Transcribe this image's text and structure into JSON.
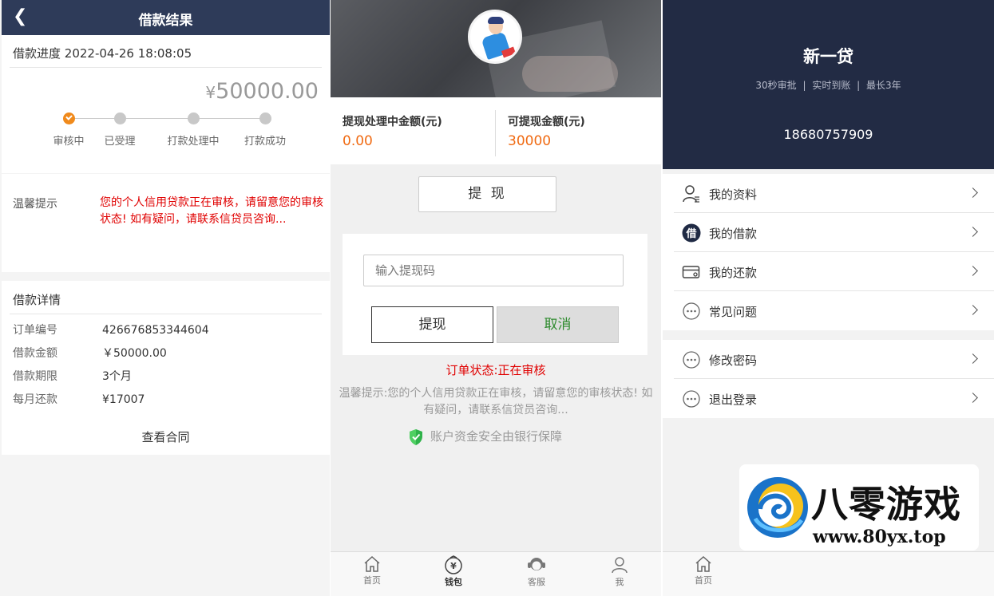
{
  "loan_result": {
    "header_title": "借款结果",
    "progress_label": "借款进度",
    "progress_time": "2022-04-26 18:08:05",
    "amount_symbol": "¥",
    "amount_value": "50000.00",
    "steps": [
      {
        "label": "审核中",
        "state": "done"
      },
      {
        "label": "已受理",
        "state": "pending"
      },
      {
        "label": "打款处理中",
        "state": "pending"
      },
      {
        "label": "打款成功",
        "state": "pending"
      }
    ],
    "tip_label": "温馨提示",
    "tip_text": "您的个人信用贷款正在审核，请留意您的审核状态! 如有疑问，请联系信贷员咨询...",
    "detail_title": "借款详情",
    "details": [
      {
        "key": "订单编号",
        "value": "426676853344604"
      },
      {
        "key": "借款金额",
        "value": "￥50000.00"
      },
      {
        "key": "借款期限",
        "value": "3个月"
      },
      {
        "key": "每月还款",
        "value": "¥17007"
      }
    ],
    "contract_label": "查看合同"
  },
  "wallet": {
    "processing_label": "提现处理中金额(元)",
    "processing_value": "0.00",
    "available_label": "可提现金额(元)",
    "available_value": "30000",
    "withdraw_button": "提 现",
    "code_placeholder": "输入提现码",
    "confirm_button": "提现",
    "cancel_button": "取消",
    "order_status": "订单状态:正在审核",
    "tip_text": "温馨提示:您的个人信用贷款正在审核，请留意您的审核状态! 如有疑问，请联系信贷员咨询...",
    "secure_text": "账户资金安全由银行保障",
    "tabs": [
      {
        "label": "首页",
        "icon": "home-icon"
      },
      {
        "label": "钱包",
        "icon": "wallet-icon",
        "active": true
      },
      {
        "label": "客服",
        "icon": "service-icon"
      },
      {
        "label": "我",
        "icon": "user-icon"
      }
    ]
  },
  "profile": {
    "app_name": "新一贷",
    "slogan": "30秒审批 | 实时到账 | 最长3年",
    "phone": "18680757909",
    "menu_group1": [
      {
        "label": "我的资料",
        "icon": "profile-icon"
      },
      {
        "label": "我的借款",
        "icon": "loan-icon"
      },
      {
        "label": "我的还款",
        "icon": "card-icon"
      },
      {
        "label": "常见问题",
        "icon": "more-icon"
      }
    ],
    "menu_group2": [
      {
        "label": "修改密码",
        "icon": "more-icon"
      },
      {
        "label": "退出登录",
        "icon": "more-icon"
      }
    ],
    "tabs": [
      {
        "label": "首页",
        "icon": "home-icon"
      }
    ]
  },
  "watermark": {
    "title": "八零游戏",
    "url": "www.80yx.top"
  },
  "colors": {
    "header_navy": "#2e3b59",
    "profile_navy": "#222b44",
    "accent_orange": "#f06a12",
    "alert_red": "#e00000",
    "success_green": "#2e8b2e"
  }
}
